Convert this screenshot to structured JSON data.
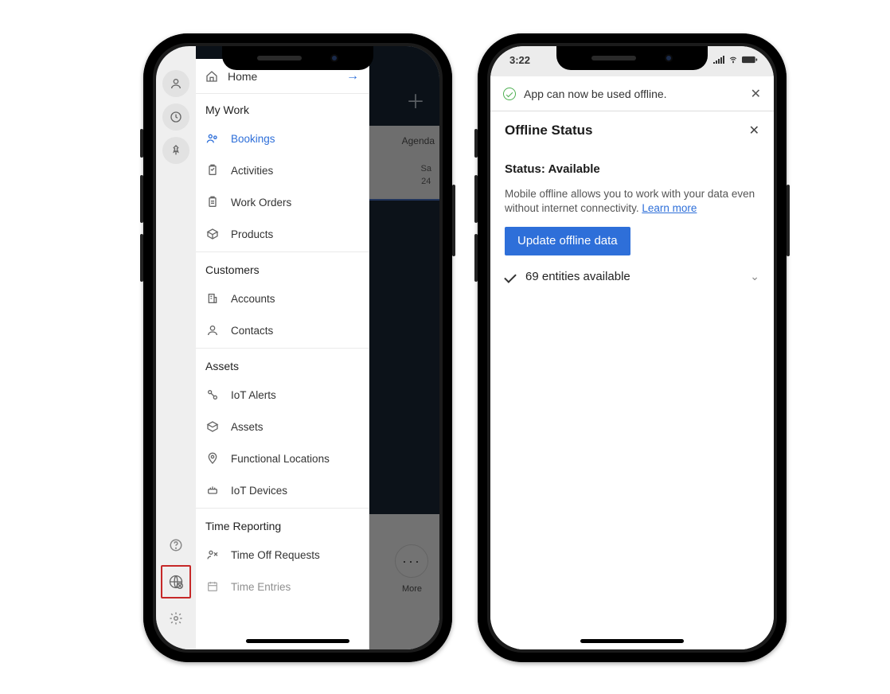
{
  "phone1": {
    "background": {
      "tabs": {
        "agenda": "Agenda"
      },
      "day_label": "Sa",
      "day_num": "24",
      "more_label": "More"
    },
    "nav": {
      "home": "Home",
      "sections": {
        "my_work": "My Work",
        "customers": "Customers",
        "assets": "Assets",
        "time_reporting": "Time Reporting"
      },
      "items": {
        "bookings": "Bookings",
        "activities": "Activities",
        "work_orders": "Work Orders",
        "products": "Products",
        "accounts": "Accounts",
        "contacts": "Contacts",
        "iot_alerts": "IoT Alerts",
        "assets_item": "Assets",
        "functional_locations": "Functional Locations",
        "iot_devices": "IoT Devices",
        "time_off_requests": "Time Off Requests",
        "time_entries": "Time Entries"
      }
    }
  },
  "phone2": {
    "status_time": "3:22",
    "toast": "App can now be used offline.",
    "panel": {
      "title": "Offline Status",
      "status_label": "Status: Available",
      "description": "Mobile offline allows you to work with your data even without internet connectivity. ",
      "learn_more": "Learn more",
      "button": "Update offline data",
      "entities": "69 entities available"
    }
  }
}
